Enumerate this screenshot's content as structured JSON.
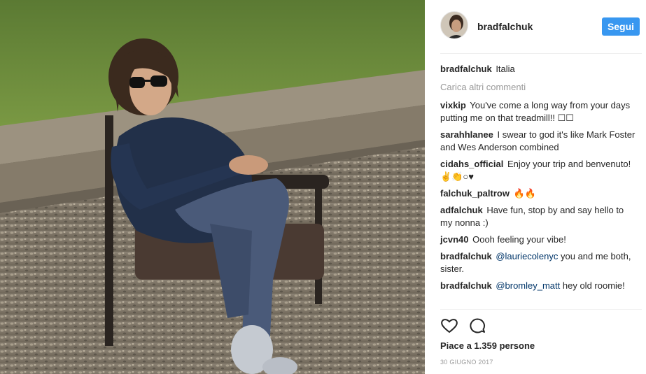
{
  "post": {
    "username": "bradfalchuk",
    "follow_label": "Segui",
    "caption": {
      "user": "bradfalchuk",
      "text": "Italia"
    },
    "load_more": "Carica altri commenti",
    "comments": [
      {
        "user": "vixkip",
        "text": "You've come a long way from your days putting me on that treadmill!! ☐☐"
      },
      {
        "user": "sarahhlanee",
        "text": "I swear to god it's like Mark Foster and Wes Anderson combined"
      },
      {
        "user": "cidahs_official",
        "text": "Enjoy your trip and benvenuto! ✌👏○♥"
      },
      {
        "user": "falchuk_paltrow",
        "text": "🔥🔥"
      },
      {
        "user": "adfalchuk",
        "text": "Have fun, stop by and say hello to my nonna :)"
      },
      {
        "user": "jcvn40",
        "text": "Oooh feeling your vibe!"
      },
      {
        "user": "bradfalchuk",
        "mention": "@lauriecolenyc",
        "text": " you and me both, sister."
      },
      {
        "user": "bradfalchuk",
        "mention": "@bromley_matt",
        "text": " hey old roomie!"
      }
    ],
    "likes": "Piace a 1.359 persone",
    "date": "30 GIUGNO 2017"
  },
  "icons": {
    "like": "heart-icon",
    "comment": "comment-bubble-icon"
  }
}
